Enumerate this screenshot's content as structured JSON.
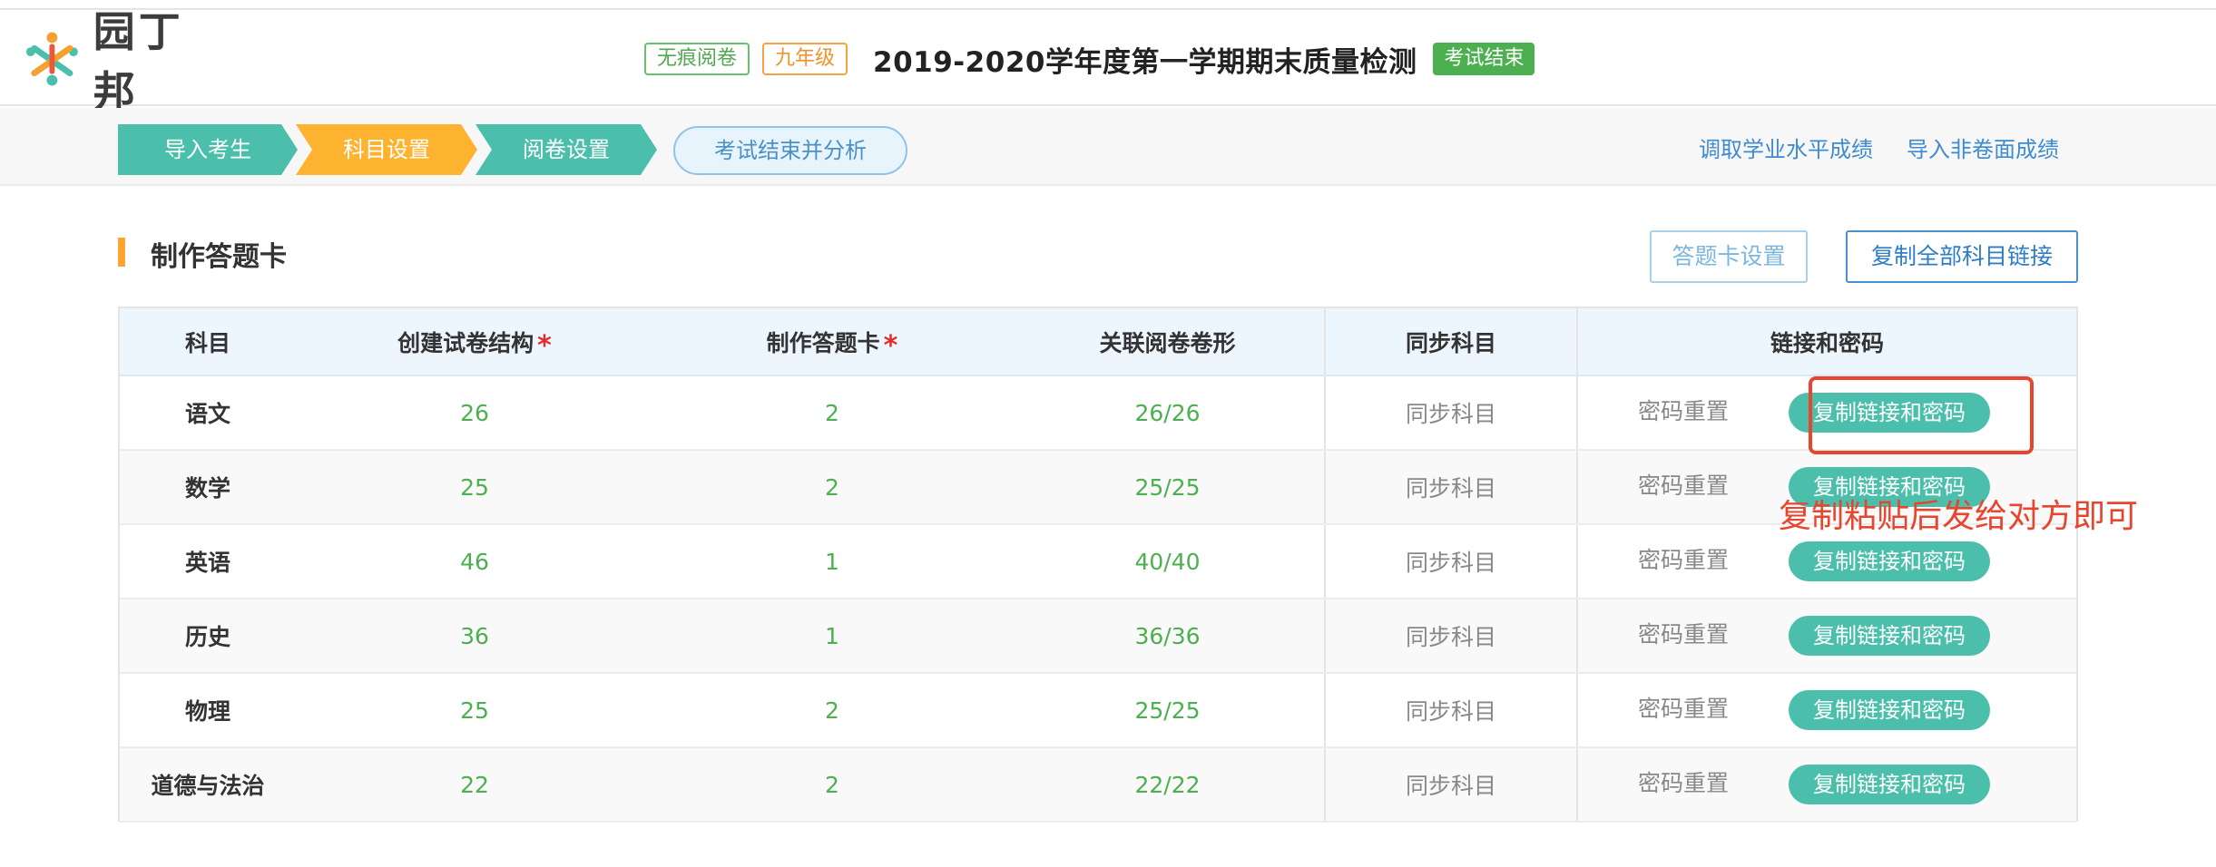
{
  "brand": {
    "name": "园丁邦",
    "colors": {
      "teal": "#4cbfac",
      "orange": "#fdb32f",
      "blue": "#3d8bd0",
      "green": "#4caf50",
      "red": "#e7452d"
    }
  },
  "header": {
    "tags": [
      "无痕阅卷",
      "九年级"
    ],
    "exam_title": "2019-2020学年度第一学期期末质量检测",
    "status": "考试结束"
  },
  "steps": {
    "items": [
      "导入考生",
      "科目设置",
      "阅卷设置"
    ],
    "final_button": "考试结束并分析",
    "links": [
      "调取学业水平成绩",
      "导入非卷面成绩"
    ]
  },
  "section": {
    "title": "制作答题卡",
    "settings_button": "答题卡设置",
    "copy_all_button": "复制全部科目链接"
  },
  "table": {
    "headers": {
      "subject": "科目",
      "structure": "创建试卷结构",
      "card": "制作答题卡",
      "shape": "关联阅卷卷形",
      "sync": "同步科目",
      "link": "链接和密码"
    },
    "required_mark": "*",
    "rows": [
      {
        "subject": "语文",
        "structure": "26",
        "card": "2",
        "shape": "26/26",
        "sync": "同步科目",
        "reset": "密码重置",
        "copy": "复制链接和密码"
      },
      {
        "subject": "数学",
        "structure": "25",
        "card": "2",
        "shape": "25/25",
        "sync": "同步科目",
        "reset": "密码重置",
        "copy": "复制链接和密码"
      },
      {
        "subject": "英语",
        "structure": "46",
        "card": "1",
        "shape": "40/40",
        "sync": "同步科目",
        "reset": "密码重置",
        "copy": "复制链接和密码"
      },
      {
        "subject": "历史",
        "structure": "36",
        "card": "1",
        "shape": "36/36",
        "sync": "同步科目",
        "reset": "密码重置",
        "copy": "复制链接和密码"
      },
      {
        "subject": "物理",
        "structure": "25",
        "card": "2",
        "shape": "25/25",
        "sync": "同步科目",
        "reset": "密码重置",
        "copy": "复制链接和密码"
      },
      {
        "subject": "道德与法治",
        "structure": "22",
        "card": "2",
        "shape": "22/22",
        "sync": "同步科目",
        "reset": "密码重置",
        "copy": "复制链接和密码"
      }
    ]
  },
  "annotation": {
    "text": "复制粘贴后发给对方即可"
  }
}
